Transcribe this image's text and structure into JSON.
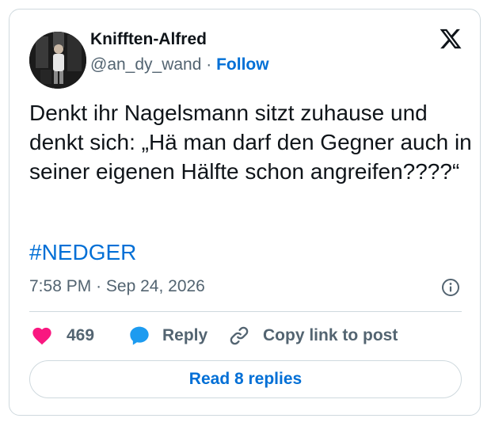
{
  "author": {
    "name": "Knifften-Alfred",
    "handle": "@an_dy_wand",
    "separator": "·",
    "follow_label": "Follow"
  },
  "tweet": {
    "text": "Denkt ihr Nagelsmann sitzt zuhause und denkt sich: „Hä man darf den Gegner auch in seiner eigenen Hälfte schon angreifen????“",
    "hashtag": "#NEDGER",
    "time": "7:58 PM",
    "date_separator": "·",
    "date": "Sep 24, 2026"
  },
  "actions": {
    "like_count": "469",
    "reply_label": "Reply",
    "copy_label": "Copy link to post"
  },
  "read_replies_label": "Read 8 replies",
  "colors": {
    "link": "#006fd6",
    "like": "#f91880",
    "reply_icon": "#1d9bf0",
    "muted": "#536471",
    "border": "#cfd9de"
  },
  "icons": [
    "x-logo-icon",
    "info-icon",
    "heart-icon",
    "reply-bubble-icon",
    "link-icon"
  ]
}
